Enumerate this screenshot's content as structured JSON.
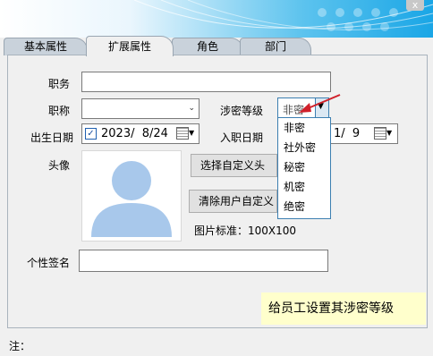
{
  "window": {
    "close_label": "x"
  },
  "tabs": [
    {
      "label": "基本属性"
    },
    {
      "label": "扩展属性"
    },
    {
      "label": "角色"
    },
    {
      "label": "部门"
    }
  ],
  "form": {
    "position_label": "职务",
    "position_value": "",
    "title_label": "职称",
    "title_value": "",
    "security_label": "涉密等级",
    "security_value": "非密",
    "birth_label": "出生日期",
    "birth_value": "2023/  8/24",
    "birth_checked": true,
    "hire_label": "入职日期",
    "hire_value": "1/  9",
    "avatar_label": "头像",
    "choose_avatar_button": "选择自定义头",
    "clear_avatar_button": "清除用户自定义",
    "image_spec": "图片标准：100X100",
    "signature_label": "个性签名",
    "signature_value": ""
  },
  "security_options": [
    "非密",
    "社外密",
    "秘密",
    "机密",
    "绝密"
  ],
  "tooltip": "给员工设置其涉密等级",
  "footer": {
    "note_label": "注："
  },
  "colors": {
    "dropdown_border": "#3c7fb1",
    "tooltip_bg": "#ffffcc",
    "arrow": "#d0202a"
  }
}
